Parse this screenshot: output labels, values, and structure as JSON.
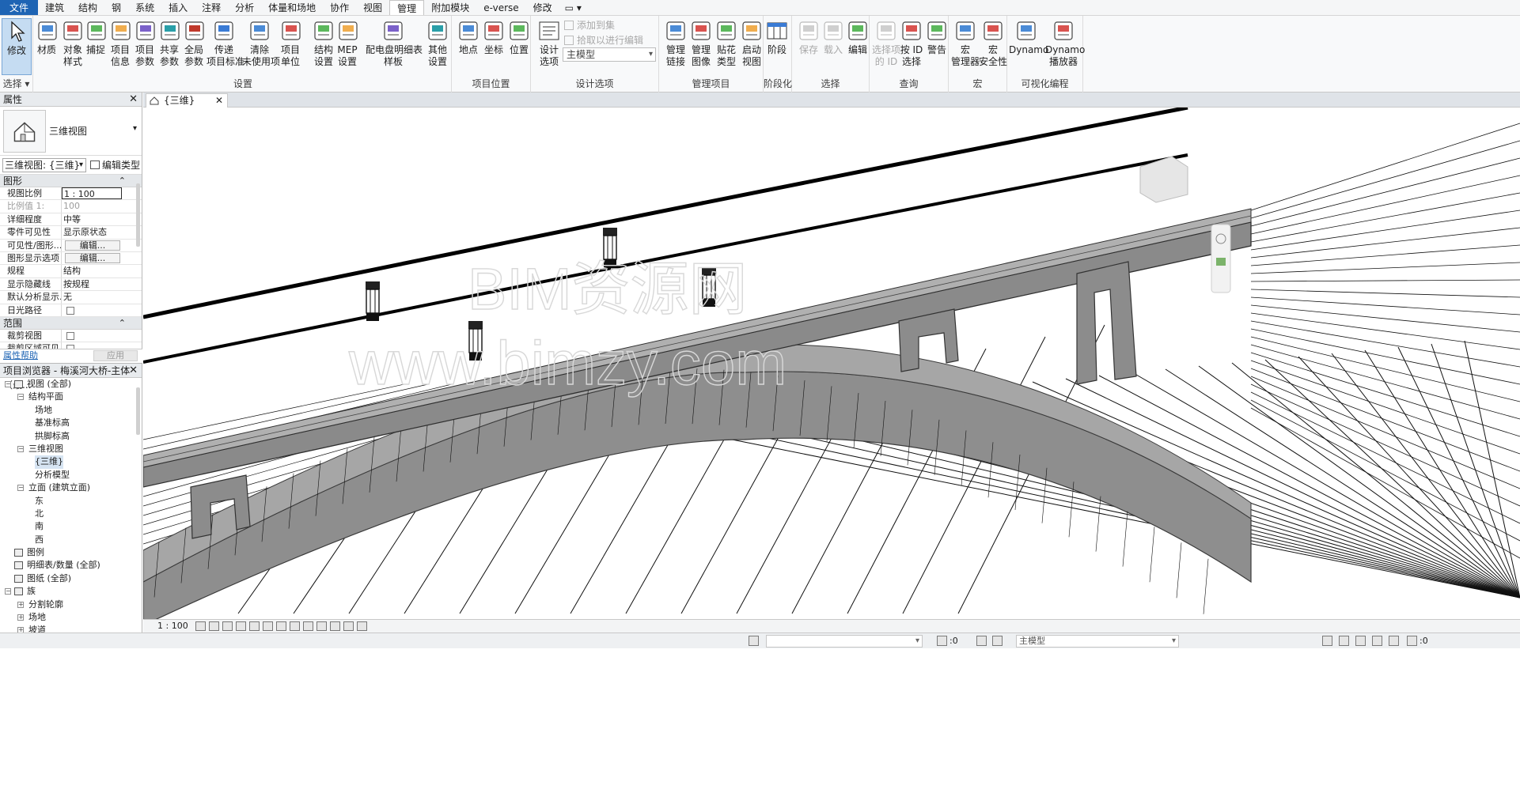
{
  "tabs": [
    "文件",
    "建筑",
    "结构",
    "钢",
    "系统",
    "插入",
    "注释",
    "分析",
    "体量和场地",
    "协作",
    "视图",
    "管理",
    "附加模块",
    "e-verse",
    "修改"
  ],
  "active_tab": "管理",
  "ribbon": {
    "select": {
      "modify_label": "修改",
      "select_label": "选择"
    },
    "settings_panel": {
      "title": "设置",
      "buttons": [
        {
          "label1": "材质",
          "label2": "",
          "icon": "materials-icon"
        },
        {
          "label1": "对象",
          "label2": "样式",
          "icon": "object-styles-icon"
        },
        {
          "label1": "捕捉",
          "label2": "",
          "icon": "snaps-icon"
        },
        {
          "label1": "项目",
          "label2": "信息",
          "icon": "project-info-icon"
        },
        {
          "label1": "项目",
          "label2": "参数",
          "icon": "project-parameters-icon"
        },
        {
          "label1": "共享",
          "label2": "参数",
          "icon": "shared-parameters-icon"
        },
        {
          "label1": "全局",
          "label2": "参数",
          "icon": "global-parameters-icon"
        },
        {
          "label1": "传递",
          "label2": "项目标准",
          "icon": "transfer-standards-icon"
        },
        {
          "label1": "清除",
          "label2": "未使用项",
          "icon": "purge-icon"
        },
        {
          "label1": "项目",
          "label2": "单位",
          "icon": "project-units-icon"
        },
        {
          "label1": "结构",
          "label2": "设置",
          "icon": "structural-settings-icon"
        },
        {
          "label1": "MEP",
          "label2": "设置",
          "icon": "mep-settings-icon"
        },
        {
          "label1": "配电盘明细表",
          "label2": "样板",
          "icon": "panel-schedule-icon"
        },
        {
          "label1": "其他",
          "label2": "设置",
          "icon": "wrench-icon"
        }
      ]
    },
    "location_panel": {
      "title": "项目位置",
      "buttons": [
        {
          "label1": "地点",
          "label2": "",
          "icon": "location-globe-icon"
        },
        {
          "label1": "坐标",
          "label2": "",
          "icon": "coordinates-icon"
        },
        {
          "label1": "位置",
          "label2": "",
          "icon": "position-icon"
        }
      ]
    },
    "design_options_panel": {
      "title": "设计选项",
      "button": {
        "label1": "设计",
        "label2": "选项"
      },
      "add_to_set": "添加到集",
      "pick_to_edit": "拾取以进行编辑",
      "main_model": "主模型"
    },
    "manage_project_panel": {
      "title": "管理项目",
      "buttons": [
        {
          "label1": "管理",
          "label2": "链接"
        },
        {
          "label1": "管理",
          "label2": "图像"
        },
        {
          "label1": "贴花",
          "label2": "类型"
        },
        {
          "label1": "启动",
          "label2": "视图"
        }
      ]
    },
    "phasing_panel": {
      "title": "阶段化",
      "button": "阶段"
    },
    "selection_panel": {
      "title": "选择",
      "buttons": [
        {
          "label": "保存",
          "disabled": true
        },
        {
          "label": "载入",
          "disabled": true
        },
        {
          "label": "编辑",
          "disabled": false
        }
      ]
    },
    "inquiry_panel": {
      "title": "查询",
      "buttons": [
        {
          "label1": "选择项",
          "label2": "的 ID",
          "disabled": true
        },
        {
          "label1": "按 ID",
          "label2": "选择",
          "disabled": false
        },
        {
          "label1": "警告",
          "label2": "",
          "disabled": false
        }
      ]
    },
    "macros_panel": {
      "title": "宏",
      "buttons": [
        {
          "label1": "宏",
          "label2": "管理器"
        },
        {
          "label1": "宏",
          "label2": "安全性"
        }
      ]
    },
    "visual_programming_panel": {
      "title": "可视化编程",
      "buttons": [
        {
          "label1": "Dynamo",
          "label2": ""
        },
        {
          "label1": "Dynamo",
          "label2": "播放器"
        }
      ]
    }
  },
  "properties": {
    "title": "属性",
    "type_name": "三维视图",
    "instance_selector": "三维视图: {三维}",
    "edit_type": "编辑类型",
    "group_graphics": "图形",
    "rows": [
      {
        "key": "视图比例",
        "value": "1 : 100",
        "style": "boxed"
      },
      {
        "key": "比例值 1:",
        "value": "100",
        "style": "gray"
      },
      {
        "key": "详细程度",
        "value": "中等",
        "style": ""
      },
      {
        "key": "零件可见性",
        "value": "显示原状态",
        "style": ""
      },
      {
        "key": "可见性/图形...",
        "value": "编辑...",
        "style": "button"
      },
      {
        "key": "图形显示选项",
        "value": "编辑...",
        "style": "button"
      },
      {
        "key": "规程",
        "value": "结构",
        "style": ""
      },
      {
        "key": "显示隐藏线",
        "value": "按规程",
        "style": ""
      },
      {
        "key": "默认分析显示...",
        "value": "无",
        "style": ""
      },
      {
        "key": "日光路径",
        "value": "",
        "style": "checkbox"
      }
    ],
    "group_extents": "范围",
    "extent_rows": [
      {
        "key": "裁剪视图",
        "value": "",
        "style": "checkbox"
      },
      {
        "key": "裁剪区域可见",
        "value": "",
        "style": "checkbox"
      }
    ],
    "help_link": "属性帮助",
    "apply": "应用"
  },
  "browser": {
    "title": "项目浏览器 - 梅溪河大桥-主体（最...",
    "nodes": [
      {
        "text": "视图 (全部)",
        "level": 0,
        "toggle": "−",
        "icon": true,
        "selected": false
      },
      {
        "text": "结构平面",
        "level": 1,
        "toggle": "−",
        "icon": false,
        "selected": false
      },
      {
        "text": "场地",
        "level": 2,
        "toggle": "",
        "icon": false,
        "selected": false
      },
      {
        "text": "基准标高",
        "level": 2,
        "toggle": "",
        "icon": false,
        "selected": false
      },
      {
        "text": "拱脚标高",
        "level": 2,
        "toggle": "",
        "icon": false,
        "selected": false
      },
      {
        "text": "三维视图",
        "level": 1,
        "toggle": "−",
        "icon": false,
        "selected": false
      },
      {
        "text": "{三维}",
        "level": 2,
        "toggle": "",
        "icon": false,
        "selected": true
      },
      {
        "text": "分析模型",
        "level": 2,
        "toggle": "",
        "icon": false,
        "selected": false
      },
      {
        "text": "立面 (建筑立面)",
        "level": 1,
        "toggle": "−",
        "icon": false,
        "selected": false
      },
      {
        "text": "东",
        "level": 2,
        "toggle": "",
        "icon": false,
        "selected": false
      },
      {
        "text": "北",
        "level": 2,
        "toggle": "",
        "icon": false,
        "selected": false
      },
      {
        "text": "南",
        "level": 2,
        "toggle": "",
        "icon": false,
        "selected": false
      },
      {
        "text": "西",
        "level": 2,
        "toggle": "",
        "icon": false,
        "selected": false
      },
      {
        "text": "图例",
        "level": 0,
        "toggle": "",
        "icon": true,
        "selected": false
      },
      {
        "text": "明细表/数量 (全部)",
        "level": 0,
        "toggle": "",
        "icon": true,
        "selected": false
      },
      {
        "text": "图纸 (全部)",
        "level": 0,
        "toggle": "",
        "icon": true,
        "selected": false
      },
      {
        "text": "族",
        "level": 0,
        "toggle": "−",
        "icon": true,
        "selected": false
      },
      {
        "text": "分割轮廓",
        "level": 1,
        "toggle": "+",
        "icon": false,
        "selected": false
      },
      {
        "text": "场地",
        "level": 1,
        "toggle": "+",
        "icon": false,
        "selected": false
      },
      {
        "text": "坡道",
        "level": 1,
        "toggle": "+",
        "icon": false,
        "selected": false
      }
    ]
  },
  "view": {
    "tab_label": "{三维}",
    "watermark_line1": "BIM资源网",
    "watermark_line2": "www.bimzy.com",
    "scale": "1 : 100",
    "model_fill": "#8d8d8d",
    "model_dark": "#5c5c5c"
  },
  "status": {
    "filter_count": ":0",
    "main_model": "主模型",
    "select_count": ":0"
  }
}
